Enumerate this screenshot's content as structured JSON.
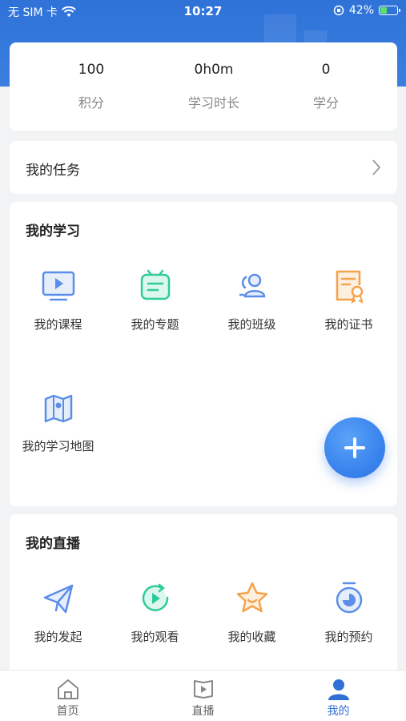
{
  "status_bar": {
    "carrier": "无 SIM 卡",
    "time": "10:27",
    "battery": "42%",
    "battery_level": 0.42
  },
  "stats": [
    {
      "value": "100",
      "label": "积分"
    },
    {
      "value": "0h0m",
      "label": "学习时长"
    },
    {
      "value": "0",
      "label": "学分"
    }
  ],
  "tasks": {
    "title": "我的任务"
  },
  "learning": {
    "title": "我的学习",
    "items": [
      {
        "label": "我的课程",
        "icon": "course-icon"
      },
      {
        "label": "我的专题",
        "icon": "topic-icon"
      },
      {
        "label": "我的班级",
        "icon": "class-icon"
      },
      {
        "label": "我的证书",
        "icon": "certificate-icon"
      },
      {
        "label": "我的学习地图",
        "icon": "map-icon"
      }
    ]
  },
  "live": {
    "title": "我的直播",
    "items": [
      {
        "label": "我的发起",
        "icon": "paper-plane-icon"
      },
      {
        "label": "我的观看",
        "icon": "play-replay-icon"
      },
      {
        "label": "我的收藏",
        "icon": "star-icon"
      },
      {
        "label": "我的预约",
        "icon": "timer-icon"
      }
    ]
  },
  "fab": {
    "icon": "plus-icon"
  },
  "tabbar": {
    "tabs": [
      {
        "label": "首页",
        "icon": "home-icon"
      },
      {
        "label": "直播",
        "icon": "live-icon"
      },
      {
        "label": "我的",
        "icon": "profile-icon"
      }
    ],
    "active": "我的"
  },
  "colors": {
    "header": "#2f72d8",
    "accent": "#2f6fd6",
    "green": "#2ecb9a",
    "orange": "#f5a24b",
    "blue_icon": "#5b8ee8"
  }
}
